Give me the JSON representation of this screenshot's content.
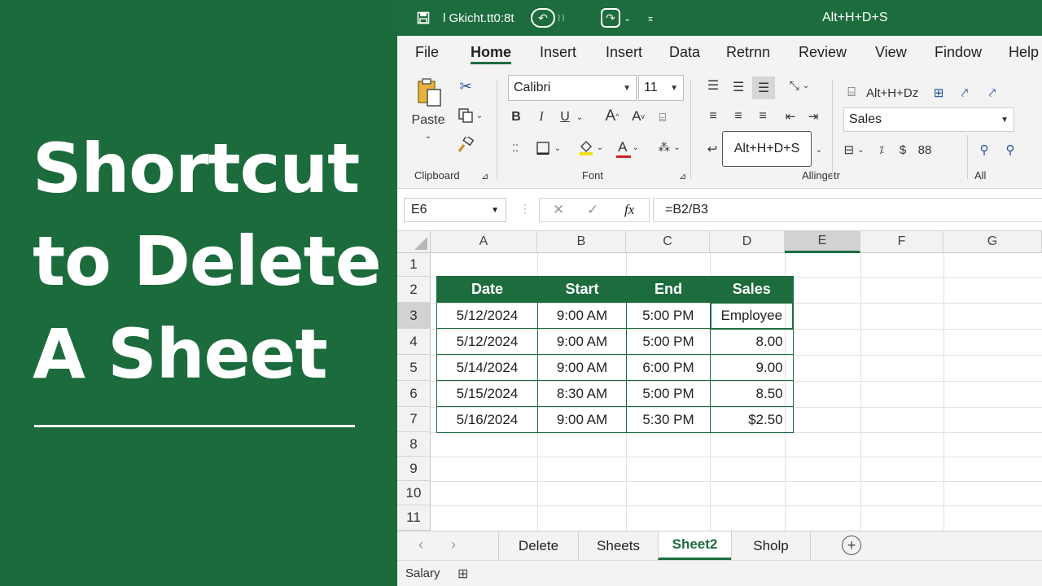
{
  "headline": {
    "line1": "Shortcut",
    "line2": "to Delete",
    "line3": "A Sheet"
  },
  "titlebar": {
    "doc_name": "l Gkicht.tt0:8t",
    "shortcut_hint": "Alt+H+D+S",
    "icons": [
      "save-icon",
      "undo-icon",
      "redo-icon",
      "customize-icon"
    ]
  },
  "menu": {
    "items": [
      "File",
      "Home",
      "Insert",
      "Insert",
      "Data",
      "Retrnn",
      "Review",
      "View",
      "Findow",
      "Help"
    ],
    "active": "Home"
  },
  "ribbon": {
    "clipboard": {
      "paste_label": "Paste",
      "group_label": "Clipboard"
    },
    "font": {
      "font_name": "Calibri",
      "font_size": "11",
      "group_label": "Font",
      "bold": "B",
      "italic": "I",
      "underline": "U"
    },
    "alignment": {
      "group_label": "Allingetr",
      "tooltip": "Alt+H+D+S"
    },
    "cells": {
      "delete_label": "Alt+H+Dz",
      "format_value": "Sales",
      "currency_symbol": "$",
      "decimal_label": "88",
      "group_label": "All"
    }
  },
  "formula_bar": {
    "name_box": "E6",
    "fx_label": "fx",
    "formula": "=B2/B3"
  },
  "grid": {
    "columns": [
      "A",
      "B",
      "C",
      "D",
      "E",
      "F",
      "G"
    ],
    "selected_column": "E",
    "rows": [
      "1",
      "2",
      "3",
      "4",
      "5",
      "6",
      "7",
      "8",
      "9",
      "10",
      "11"
    ],
    "selected_row": "3",
    "table": {
      "headers": [
        "Date",
        "Start",
        "End",
        "Sales"
      ],
      "rows": [
        [
          "5/12/2024",
          "9:00 AM",
          "5:00 PM",
          "Employee"
        ],
        [
          "5/12/2024",
          "9:00 AM",
          "5:00 PM",
          "8.00"
        ],
        [
          "5/14/2024",
          "9:00 AM",
          "6:00 PM",
          "9.00"
        ],
        [
          "5/15/2024",
          "8:30 AM",
          "5:00 PM",
          "8.50"
        ],
        [
          "5/16/2024",
          "9:00 AM",
          "5:30 PM",
          "$2.50"
        ]
      ]
    }
  },
  "sheet_tabs": {
    "tabs": [
      "Delete",
      "Sheets",
      "Sheet2",
      "Sholp"
    ],
    "active": "Sheet2"
  },
  "status": {
    "text": "Salary"
  },
  "colors": {
    "brand_green": "#1d6c3e",
    "panel_green": "#1b6b3d"
  }
}
